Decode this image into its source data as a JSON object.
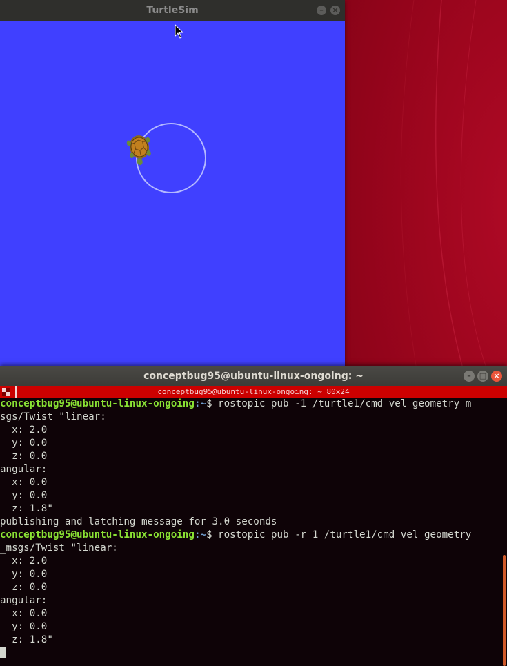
{
  "turtlesim": {
    "title": "TurtleSim",
    "canvas_color": "#4040ff",
    "path_color": "#b3b8ff"
  },
  "terminal": {
    "title": "conceptbug95@ubuntu-linux-ongoing: ~",
    "infobar": "conceptbug95@ubuntu-linux-ongoing: ~ 80x24",
    "lines": [
      {
        "user": "conceptbug95@ubuntu-linux-ongoing",
        "path": ":~",
        "text": "$ rostopic pub -1 /turtle1/cmd_vel geometry_m"
      },
      {
        "text": "sgs/Twist \"linear:"
      },
      {
        "text": "  x: 2.0"
      },
      {
        "text": "  y: 0.0"
      },
      {
        "text": "  z: 0.0"
      },
      {
        "text": "angular:"
      },
      {
        "text": "  x: 0.0"
      },
      {
        "text": "  y: 0.0"
      },
      {
        "text": "  z: 1.8\""
      },
      {
        "text": "publishing and latching message for 3.0 seconds"
      },
      {
        "user": "conceptbug95@ubuntu-linux-ongoing",
        "path": ":~",
        "text": "$ rostopic pub -r 1 /turtle1/cmd_vel geometry"
      },
      {
        "text": "_msgs/Twist \"linear:"
      },
      {
        "text": "  x: 2.0"
      },
      {
        "text": "  y: 0.0"
      },
      {
        "text": "  z: 0.0"
      },
      {
        "text": "angular:"
      },
      {
        "text": "  x: 0.0"
      },
      {
        "text": "  y: 0.0"
      },
      {
        "text": "  z: 1.8\""
      }
    ]
  },
  "colors": {
    "wallpaper": "#8a0318",
    "prompt_user": "#8ae234",
    "prompt_path": "#729fcf",
    "infobar": "#cc0000"
  }
}
